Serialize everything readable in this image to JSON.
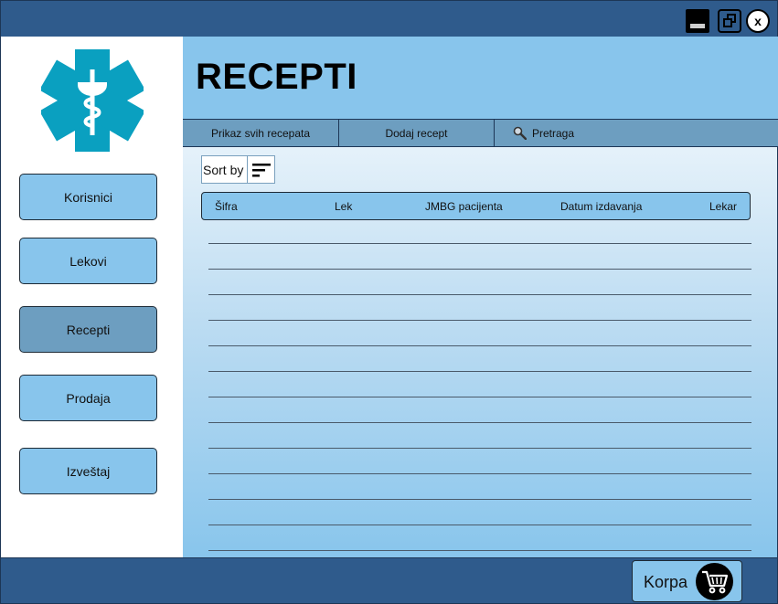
{
  "window": {
    "controls": {
      "minimize_icon": "minimize-icon",
      "restore_icon": "restore-icon",
      "close_label": "x"
    }
  },
  "sidebar": {
    "logo_icon": "medical-star-of-life-icon",
    "items": [
      {
        "label": "Korisnici",
        "active": false
      },
      {
        "label": "Lekovi",
        "active": false
      },
      {
        "label": "Recepti",
        "active": true
      },
      {
        "label": "Prodaja",
        "active": false
      },
      {
        "label": "Izveštaj",
        "active": false
      }
    ]
  },
  "main": {
    "title": "RECEPTI",
    "tabs": [
      {
        "label": "Prikaz svih recepata"
      },
      {
        "label": "Dodaj recept"
      },
      {
        "label": "Pretraga",
        "icon": "magnifier-icon"
      }
    ],
    "sort": {
      "label": "Sort by",
      "icon": "sort-lines-icon"
    },
    "table": {
      "columns": [
        "Šifra",
        "Lek",
        "JMBG pacijenta",
        "Datum izdavanja",
        "Lekar"
      ],
      "rows": []
    }
  },
  "footer": {
    "cart_label": "Korpa",
    "cart_icon": "shopping-cart-icon"
  },
  "colors": {
    "titlebar": "#2f5b8c",
    "accent_light": "#88c5ec",
    "accent_active": "#6d9ec0",
    "logo": "#0aa0c0"
  }
}
